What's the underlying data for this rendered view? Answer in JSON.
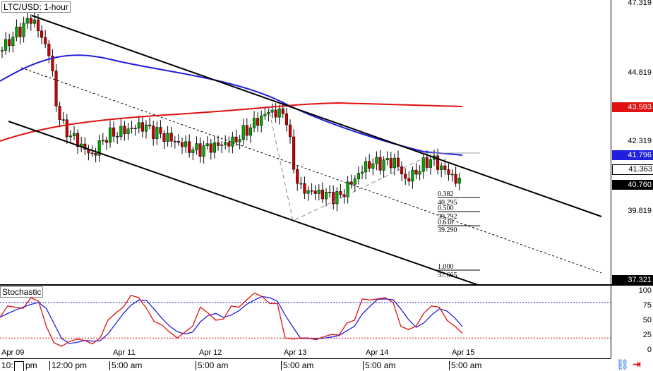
{
  "chart": {
    "title": "LTC/USD: 1-hour",
    "indicator": "Stochastic"
  },
  "price_axis": {
    "labels": [
      "47.319",
      "44.819",
      "42.319",
      "39.819",
      "37.321"
    ],
    "tags": {
      "ma_red": "43.593",
      "ma_blue": "41.796",
      "prev": "41.363",
      "last": "40.760",
      "low": "37.321"
    }
  },
  "colors": {
    "up": "#00aa00",
    "down": "#cc0000",
    "ma_blue": "#1f1fdd",
    "ma_red": "#e01010"
  },
  "fib": [
    {
      "ratio": "0.382",
      "price": "40.295"
    },
    {
      "ratio": "0.500",
      "price": "39.792"
    },
    {
      "ratio": "0.618",
      "price": "39.290"
    },
    {
      "ratio": "1.000",
      "price": "37.665"
    }
  ],
  "stoch_axis": [
    "100",
    "75",
    "50",
    "25",
    "0"
  ],
  "date_labels": [
    "Apr 09",
    "Apr 11",
    "Apr 12",
    "Apr 13",
    "Apr 14",
    "Apr 15"
  ],
  "time_labels": [
    "10:",
    "pm",
    "12:00 pm",
    "5:00 am",
    "5:00 am",
    "5:00 am",
    "5:00 am",
    "5:00 am"
  ],
  "price_path": [
    [
      0,
      45.6
    ],
    [
      45,
      46.8
    ],
    [
      70,
      45.5
    ],
    [
      80,
      43.6
    ],
    [
      90,
      42.8
    ],
    [
      130,
      41.8
    ],
    [
      150,
      42.5
    ],
    [
      200,
      42.9
    ],
    [
      275,
      42.0
    ],
    [
      330,
      42.3
    ],
    [
      380,
      43.4
    ],
    [
      405,
      43.3
    ],
    [
      415,
      41.5
    ],
    [
      425,
      40.6
    ],
    [
      480,
      40.3
    ],
    [
      520,
      41.5
    ],
    [
      560,
      41.6
    ],
    [
      575,
      40.9
    ],
    [
      610,
      41.7
    ],
    [
      655,
      40.76
    ]
  ],
  "stoch_k": [
    55,
    74,
    72,
    70,
    88,
    82,
    40,
    12,
    6,
    14,
    18,
    16,
    10,
    20,
    50,
    62,
    72,
    92,
    88,
    70,
    48,
    42,
    30,
    20,
    30,
    40,
    72,
    62,
    50,
    52,
    74,
    72,
    84,
    96,
    90,
    78,
    78,
    20,
    18,
    20,
    20,
    17,
    22,
    26,
    25,
    45,
    50,
    86,
    84,
    86,
    88,
    80,
    40,
    34,
    40,
    62,
    74,
    72,
    50,
    40,
    28
  ]
}
